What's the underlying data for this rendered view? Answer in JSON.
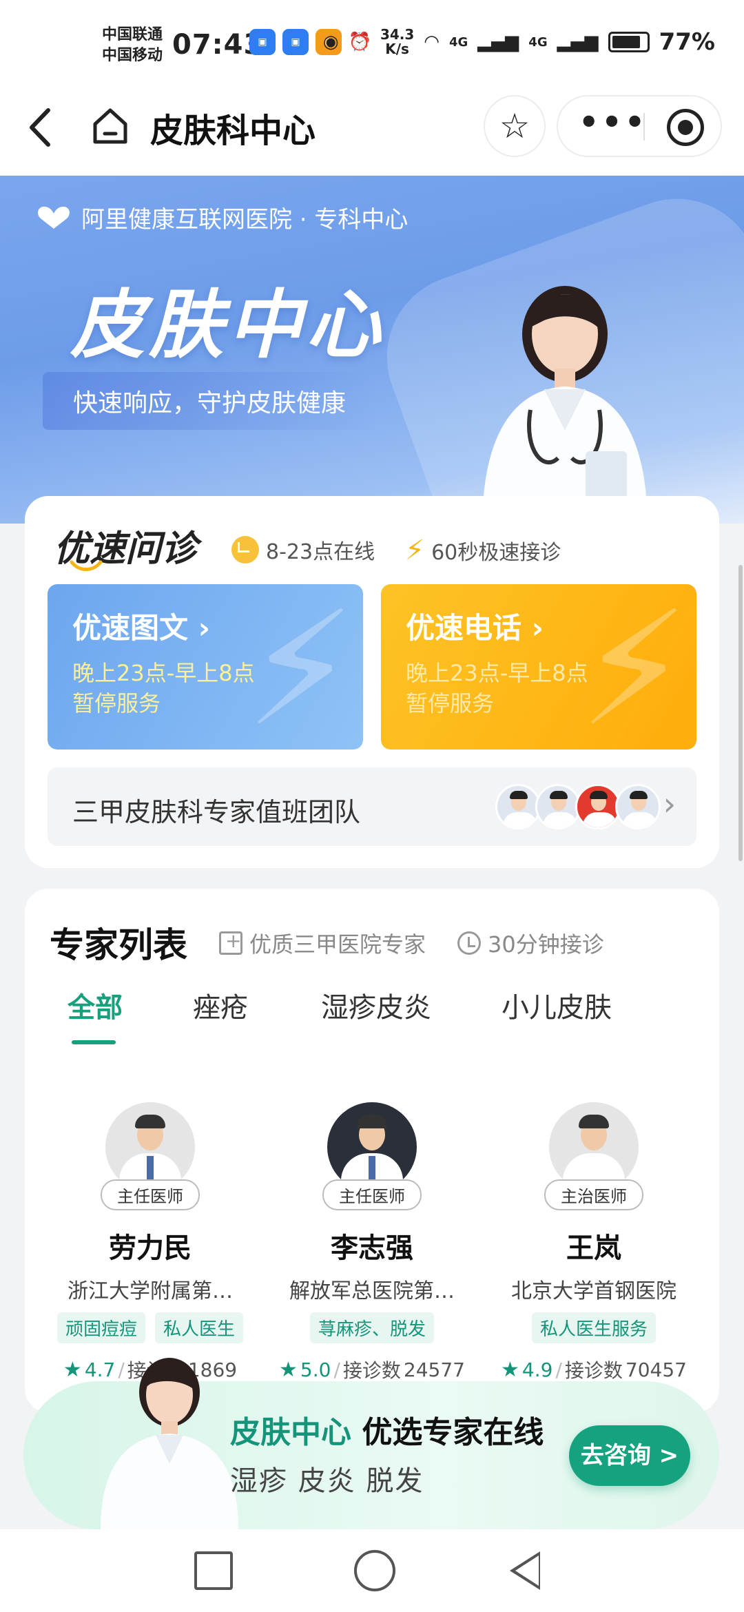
{
  "status_bar": {
    "carrier_1": "中国联通",
    "carrier_2": "中国移动",
    "time": "07:43",
    "net_speed_value": "34.3",
    "net_speed_unit": "K/s",
    "signal_1": "4G",
    "signal_2": "4G",
    "battery": "77%",
    "app_icons": [
      "bus-app-icon",
      "bus-app-icon",
      "imou-app-icon",
      "flower-app-icon"
    ]
  },
  "navbar": {
    "title": "皮肤科中心",
    "more_label": "•••"
  },
  "banner": {
    "hospital": "阿里健康互联网医院 · 专科中心",
    "title": "皮肤中心",
    "subtitle": "快速响应，守护皮肤健康"
  },
  "quick_consult": {
    "title": "优速问诊",
    "feature_hours": "8-23点在线",
    "feature_speed": "60秒极速接诊",
    "options": [
      {
        "title": "优速图文 ›",
        "line1": "晚上23点-早上8点",
        "line2": "暂停服务"
      },
      {
        "title": "优速电话 ›",
        "line1": "晚上23点-早上8点",
        "line2": "暂停服务"
      }
    ],
    "team_label": "三甲皮肤科专家值班团队"
  },
  "experts": {
    "title": "专家列表",
    "feature_1": "优质三甲医院专家",
    "feature_2": "30分钟接诊",
    "tabs": [
      "全部",
      "痤疮",
      "湿疹皮炎",
      "小儿皮肤"
    ],
    "active_tab": 0,
    "doctors": [
      {
        "title": "主任医师",
        "name": "劳力民",
        "hospital": "浙江大学附属第…",
        "tags": [
          "顽固痘痘",
          "私人医生"
        ],
        "rating": "4.7",
        "consult_label": "接诊数",
        "consult_count": "1869"
      },
      {
        "title": "主任医师",
        "name": "李志强",
        "hospital": "解放军总医院第…",
        "tags": [
          "荨麻疹、脱发"
        ],
        "rating": "5.0",
        "consult_label": "接诊数",
        "consult_count": "24577"
      },
      {
        "title": "主治医师",
        "name": "王岚",
        "hospital": "北京大学首钢医院",
        "tags": [
          "私人医生服务"
        ],
        "rating": "4.9",
        "consult_label": "接诊数",
        "consult_count": "70457"
      }
    ]
  },
  "promo": {
    "title_green": "皮肤中心",
    "title_rest": "优选专家在线",
    "subtitle": "湿疹 皮炎 脱发",
    "button": "去咨询 >"
  },
  "colors": {
    "accent_green": "#14957a",
    "banner_blue": "#6d9ce9",
    "yellow": "#fdc326"
  }
}
